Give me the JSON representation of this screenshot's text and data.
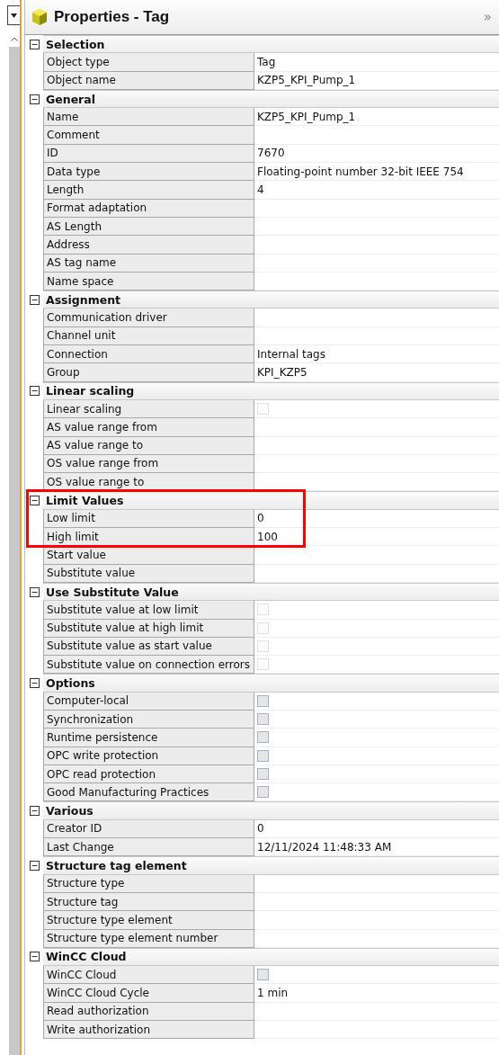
{
  "panel": {
    "title": "Properties - Tag",
    "collapse_glyph": "»"
  },
  "sections": [
    {
      "title": "Selection",
      "expanded": true,
      "highlighted": false,
      "rows": [
        {
          "label": "Object type",
          "kind": "text",
          "value": "Tag"
        },
        {
          "label": "Object name",
          "kind": "text",
          "value": "KZP5_KPI_Pump_1"
        }
      ]
    },
    {
      "title": "General",
      "expanded": true,
      "highlighted": false,
      "rows": [
        {
          "label": "Name",
          "kind": "text",
          "value": "KZP5_KPI_Pump_1"
        },
        {
          "label": "Comment",
          "kind": "text"
        },
        {
          "label": "ID",
          "kind": "text",
          "value": "7670"
        },
        {
          "label": "Data type",
          "kind": "text",
          "value": "Floating-point number 32-bit IEEE 754"
        },
        {
          "label": "Length",
          "kind": "text",
          "value": "4"
        },
        {
          "label": "Format adaptation",
          "kind": "text"
        },
        {
          "label": "AS Length",
          "kind": "text"
        },
        {
          "label": "Address",
          "kind": "text"
        },
        {
          "label": "AS tag name",
          "kind": "text"
        },
        {
          "label": "Name space",
          "kind": "text"
        }
      ]
    },
    {
      "title": "Assignment",
      "expanded": true,
      "highlighted": false,
      "rows": [
        {
          "label": "Communication driver",
          "kind": "text"
        },
        {
          "label": "Channel unit",
          "kind": "text"
        },
        {
          "label": "Connection",
          "kind": "text",
          "value": "Internal tags"
        },
        {
          "label": "Group",
          "kind": "text",
          "value": "KPI_KZP5"
        }
      ]
    },
    {
      "title": "Linear scaling",
      "expanded": true,
      "highlighted": false,
      "rows": [
        {
          "label": "Linear scaling",
          "kind": "checkbox",
          "checked": false,
          "disabled": true
        },
        {
          "label": "AS value range from",
          "kind": "text"
        },
        {
          "label": "AS value range to",
          "kind": "text"
        },
        {
          "label": "OS value range from",
          "kind": "text"
        },
        {
          "label": "OS value range to",
          "kind": "text"
        }
      ]
    },
    {
      "title": "Limit Values",
      "expanded": true,
      "highlighted": true,
      "rows": [
        {
          "label": "Low limit",
          "kind": "text",
          "value": "0",
          "highlighted": true
        },
        {
          "label": "High limit",
          "kind": "text",
          "value": "100",
          "highlighted": true
        },
        {
          "label": "Start value",
          "kind": "text",
          "highlighted": false
        },
        {
          "label": "Substitute value",
          "kind": "text",
          "highlighted": false
        }
      ]
    },
    {
      "title": "Use Substitute Value",
      "expanded": true,
      "highlighted": false,
      "rows": [
        {
          "label": "Substitute value at low limit",
          "kind": "checkbox",
          "checked": false,
          "disabled": true
        },
        {
          "label": "Substitute value at high limit",
          "kind": "checkbox",
          "checked": false,
          "disabled": true
        },
        {
          "label": "Substitute value as start value",
          "kind": "checkbox",
          "checked": false,
          "disabled": true
        },
        {
          "label": "Substitute value on connection errors",
          "kind": "checkbox",
          "checked": false,
          "disabled": true
        }
      ]
    },
    {
      "title": "Options",
      "expanded": true,
      "highlighted": false,
      "rows": [
        {
          "label": "Computer-local",
          "kind": "checkbox",
          "checked": false,
          "disabled": false
        },
        {
          "label": "Synchronization",
          "kind": "checkbox",
          "checked": false,
          "disabled": false
        },
        {
          "label": "Runtime persistence",
          "kind": "checkbox",
          "checked": false,
          "disabled": false
        },
        {
          "label": "OPC write protection",
          "kind": "checkbox",
          "checked": false,
          "disabled": false
        },
        {
          "label": "OPC read protection",
          "kind": "checkbox",
          "checked": false,
          "disabled": false
        },
        {
          "label": "Good Manufacturing Practices",
          "kind": "checkbox",
          "checked": false,
          "disabled": false
        }
      ]
    },
    {
      "title": "Various",
      "expanded": true,
      "highlighted": false,
      "rows": [
        {
          "label": "Creator ID",
          "kind": "text",
          "value": "0"
        },
        {
          "label": "Last Change",
          "kind": "text",
          "value": "12/11/2024 11:48:33 AM"
        }
      ]
    },
    {
      "title": "Structure tag element",
      "expanded": true,
      "highlighted": false,
      "rows": [
        {
          "label": "Structure type",
          "kind": "text"
        },
        {
          "label": "Structure tag",
          "kind": "text"
        },
        {
          "label": "Structure type element",
          "kind": "text"
        },
        {
          "label": "Structure type element number",
          "kind": "text"
        }
      ]
    },
    {
      "title": "WinCC Cloud",
      "expanded": true,
      "highlighted": false,
      "rows": [
        {
          "label": "WinCC Cloud",
          "kind": "checkbox",
          "checked": false,
          "disabled": false
        },
        {
          "label": "WinCC Cloud Cycle",
          "kind": "text",
          "value": "1 min"
        },
        {
          "label": "Read authorization",
          "kind": "text"
        },
        {
          "label": "Write authorization",
          "kind": "text"
        }
      ]
    }
  ]
}
